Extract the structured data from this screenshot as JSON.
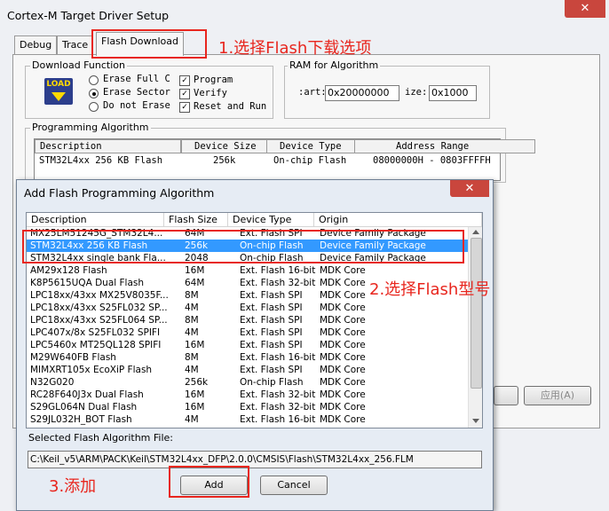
{
  "outer": {
    "title": "Cortex-M Target Driver Setup",
    "close_glyph": "✕",
    "tabs": [
      "Debug",
      "Trace",
      "Flash Download"
    ],
    "download_function": {
      "title": "Download Function",
      "logo_line1": "LOAD",
      "radios": [
        "Erase Full C",
        "Erase Sector",
        "Do not Erase"
      ],
      "checks": [
        "Program",
        "Verify",
        "Reset and Run"
      ]
    },
    "ram": {
      "title": "RAM for Algorithm",
      "start_label": ":art:",
      "start_value": "0x20000000",
      "size_label": "ize:",
      "size_value": "0x1000"
    },
    "programming": {
      "title": "Programming Algorithm",
      "columns": [
        "Description",
        "Device Size",
        "Device Type",
        "Address Range"
      ],
      "row": [
        "STM32L4xx 256 KB Flash",
        "256k",
        "On-chip Flash",
        "08000000H - 0803FFFFH"
      ]
    },
    "apply_button": "应用(A)"
  },
  "annotations": {
    "step1": "1.选择Flash下载选项",
    "step2": "2.选择Flash型号",
    "step3": "3.添加"
  },
  "dialog": {
    "title": "Add Flash Programming Algorithm",
    "close_glyph": "✕",
    "columns": [
      "Description",
      "Flash Size",
      "Device Type",
      "Origin"
    ],
    "rows": [
      [
        "MX25LM51245G_STM32L4...",
        "64M",
        "Ext. Flash SPI",
        "Device Family Package"
      ],
      [
        "STM32L4xx 256 KB Flash",
        "256k",
        "On-chip Flash",
        "Device Family Package"
      ],
      [
        "STM32L4xx single bank Fla...",
        "2048",
        "On-chip Flash",
        "Device Family Package"
      ],
      [
        "AM29x128 Flash",
        "16M",
        "Ext. Flash 16-bit",
        "MDK Core"
      ],
      [
        "K8P5615UQA Dual Flash",
        "64M",
        "Ext. Flash 32-bit",
        "MDK Core"
      ],
      [
        "LPC18xx/43xx MX25V8035F...",
        "8M",
        "Ext. Flash SPI",
        "MDK Core"
      ],
      [
        "LPC18xx/43xx S25FL032 SP...",
        "4M",
        "Ext. Flash SPI",
        "MDK Core"
      ],
      [
        "LPC18xx/43xx S25FL064 SP...",
        "8M",
        "Ext. Flash SPI",
        "MDK Core"
      ],
      [
        "LPC407x/8x S25FL032 SPIFI",
        "4M",
        "Ext. Flash SPI",
        "MDK Core"
      ],
      [
        "LPC5460x MT25QL128 SPIFI",
        "16M",
        "Ext. Flash SPI",
        "MDK Core"
      ],
      [
        "M29W640FB Flash",
        "8M",
        "Ext. Flash 16-bit",
        "MDK Core"
      ],
      [
        "MIMXRT105x EcoXiP Flash",
        "4M",
        "Ext. Flash SPI",
        "MDK Core"
      ],
      [
        "N32G020",
        "256k",
        "On-chip Flash",
        "MDK Core"
      ],
      [
        "RC28F640J3x Dual Flash",
        "16M",
        "Ext. Flash 32-bit",
        "MDK Core"
      ],
      [
        "S29GL064N Dual Flash",
        "16M",
        "Ext. Flash 32-bit",
        "MDK Core"
      ],
      [
        "S29JL032H_BOT Flash",
        "4M",
        "Ext. Flash 16-bit",
        "MDK Core"
      ]
    ],
    "selected_file_label": "Selected Flash Algorithm File:",
    "selected_file_path": "C:\\Keil_v5\\ARM\\PACK\\Keil\\STM32L4xx_DFP\\2.0.0\\CMSIS\\Flash\\STM32L4xx_256.FLM",
    "add_button": "Add",
    "cancel_button": "Cancel"
  },
  "colors": {
    "highlight": "#3399ff",
    "annotation_red": "#e8261e"
  }
}
